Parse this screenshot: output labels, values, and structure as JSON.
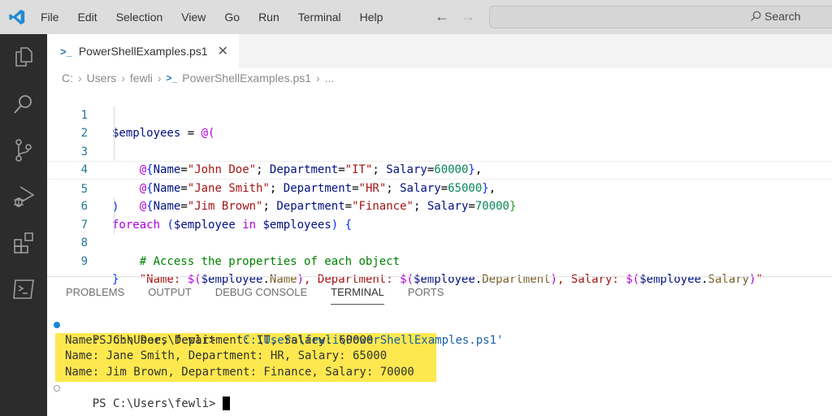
{
  "titlebar": {
    "menu": [
      "File",
      "Edit",
      "Selection",
      "View",
      "Go",
      "Run",
      "Terminal",
      "Help"
    ],
    "search_label": "Search"
  },
  "activity_bar": [
    "explorer-icon",
    "search-icon",
    "source-control-icon",
    "run-debug-icon",
    "extensions-icon",
    "terminal-icon"
  ],
  "tab": {
    "label": "PowerShellExamples.ps1",
    "close": "✕",
    "icon": "powershell-icon"
  },
  "breadcrumb": {
    "items": [
      "C:",
      "Users",
      "fewli",
      "PowerShellExamples.ps1",
      "..."
    ]
  },
  "editor": {
    "line_numbers": [
      "1",
      "2",
      "3",
      "4",
      "5",
      "6",
      "7",
      "8",
      "9"
    ],
    "lines": [
      "$employees = @(",
      "    @{Name=\"John Doe\"; Department=\"IT\"; Salary=60000},",
      "    @{Name=\"Jane Smith\"; Department=\"HR\"; Salary=65000},",
      "    @{Name=\"Jim Brown\"; Department=\"Finance\"; Salary=70000}",
      ")",
      "foreach ($employee in $employees) {",
      "    # Access the properties of each object",
      "    \"Name: $($employee.Name), Department: $($employee.Department), Salary: $($employee.Salary)\"",
      "}"
    ],
    "employees": [
      {
        "name": "John Doe",
        "department": "IT",
        "salary": "60000"
      },
      {
        "name": "Jane Smith",
        "department": "HR",
        "salary": "65000"
      },
      {
        "name": "Jim Brown",
        "department": "Finance",
        "salary": "70000"
      }
    ],
    "comment": "# Access the properties of each object"
  },
  "panel": {
    "tabs": [
      "PROBLEMS",
      "OUTPUT",
      "DEBUG CONSOLE",
      "TERMINAL",
      "PORTS"
    ],
    "active_tab": "TERMINAL"
  },
  "terminal": {
    "prompt": "PS C:\\Users\\fewli> ",
    "command": ". 'C:\\Users\\fewli\\PowerShellExamples.ps1'",
    "output": [
      "Name: John Doe, Department: IT, Salary: 60000",
      "Name: Jane Smith, Department: HR, Salary: 65000",
      "Name: Jim Brown, Department: Finance, Salary: 70000"
    ],
    "final_prompt": "PS C:\\Users\\fewli> "
  },
  "colors": {
    "highlight": "#fde84f",
    "accent": "#1a85d6",
    "activity_bar": "#2c2c2c"
  }
}
